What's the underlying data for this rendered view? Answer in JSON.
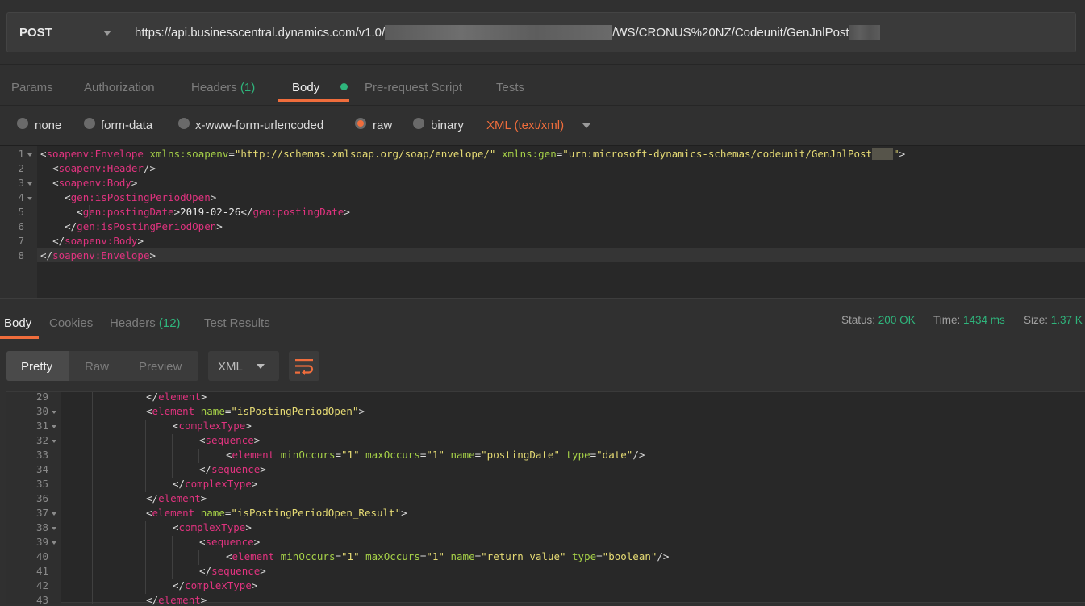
{
  "request": {
    "method": "POST",
    "url_prefix": "https://api.businesscentral.dynamics.com/v1.0/",
    "url_middle": "/WS/CRONUS%20NZ/Codeunit/GenJnlPost"
  },
  "request_tabs": {
    "params": "Params",
    "authorization": "Authorization",
    "headers": "Headers",
    "headers_count": "(1)",
    "body": "Body",
    "pre_request": "Pre-request Script",
    "tests": "Tests"
  },
  "body_modes": {
    "none": "none",
    "form_data": "form-data",
    "urlencoded": "x-www-form-urlencoded",
    "raw": "raw",
    "binary": "binary",
    "selected": "raw",
    "content_type": "XML (text/xml)"
  },
  "request_body": {
    "line_numbers": [
      "1",
      "2",
      "3",
      "4",
      "5",
      "6",
      "7",
      "8"
    ],
    "l1_tag": "soapenv:Envelope",
    "l1_attr1": "xmlns:soapenv",
    "l1_val1": "\"http://schemas.xmlsoap.org/soap/envelope/\"",
    "l1_attr2": "xmlns:gen",
    "l1_val2": "\"urn:microsoft-dynamics-schemas/codeunit/GenJnlPost",
    "l2_tag": "soapenv:Header",
    "l3_tag": "soapenv:Body",
    "l4_tag": "gen:isPostingPeriodOpen",
    "l5_tag": "gen:postingDate",
    "l5_text": "2019-02-26",
    "l6_tag": "gen:isPostingPeriodOpen",
    "l7_tag": "soapenv:Body",
    "l8_tag": "soapenv:Envelope"
  },
  "response_tabs": {
    "body": "Body",
    "cookies": "Cookies",
    "headers": "Headers",
    "headers_count": "(12)",
    "test_results": "Test Results"
  },
  "response_status": {
    "status_label": "Status:",
    "status_value": "200 OK",
    "time_label": "Time:",
    "time_value": "1434 ms",
    "size_label": "Size:",
    "size_value": "1.37 K"
  },
  "view_toolbar": {
    "pretty": "Pretty",
    "raw": "Raw",
    "preview": "Preview",
    "format": "XML",
    "wrap_icon": "wrap-lines-icon"
  },
  "response_body": {
    "line_numbers": [
      "29",
      "30",
      "31",
      "32",
      "33",
      "34",
      "35",
      "36",
      "37",
      "38",
      "39",
      "40",
      "41",
      "42",
      "43"
    ],
    "element": "element",
    "complexType": "complexType",
    "sequence": "sequence",
    "name_attr": "name",
    "minOccurs_attr": "minOccurs",
    "maxOccurs_attr": "maxOccurs",
    "type_attr": "type",
    "v_isPostingPeriodOpen": "\"isPostingPeriodOpen\"",
    "v_isPostingPeriodOpen_Result": "\"isPostingPeriodOpen_Result\"",
    "v_one": "\"1\"",
    "v_postingDate": "\"postingDate\"",
    "v_date": "\"date\"",
    "v_return_value": "\"return_value\"",
    "v_boolean": "\"boolean\""
  },
  "colors": {
    "accent": "#f06d3c",
    "green": "#2fb57c",
    "tag": "#e0337f",
    "attr": "#a6d148",
    "string": "#e6db74"
  }
}
